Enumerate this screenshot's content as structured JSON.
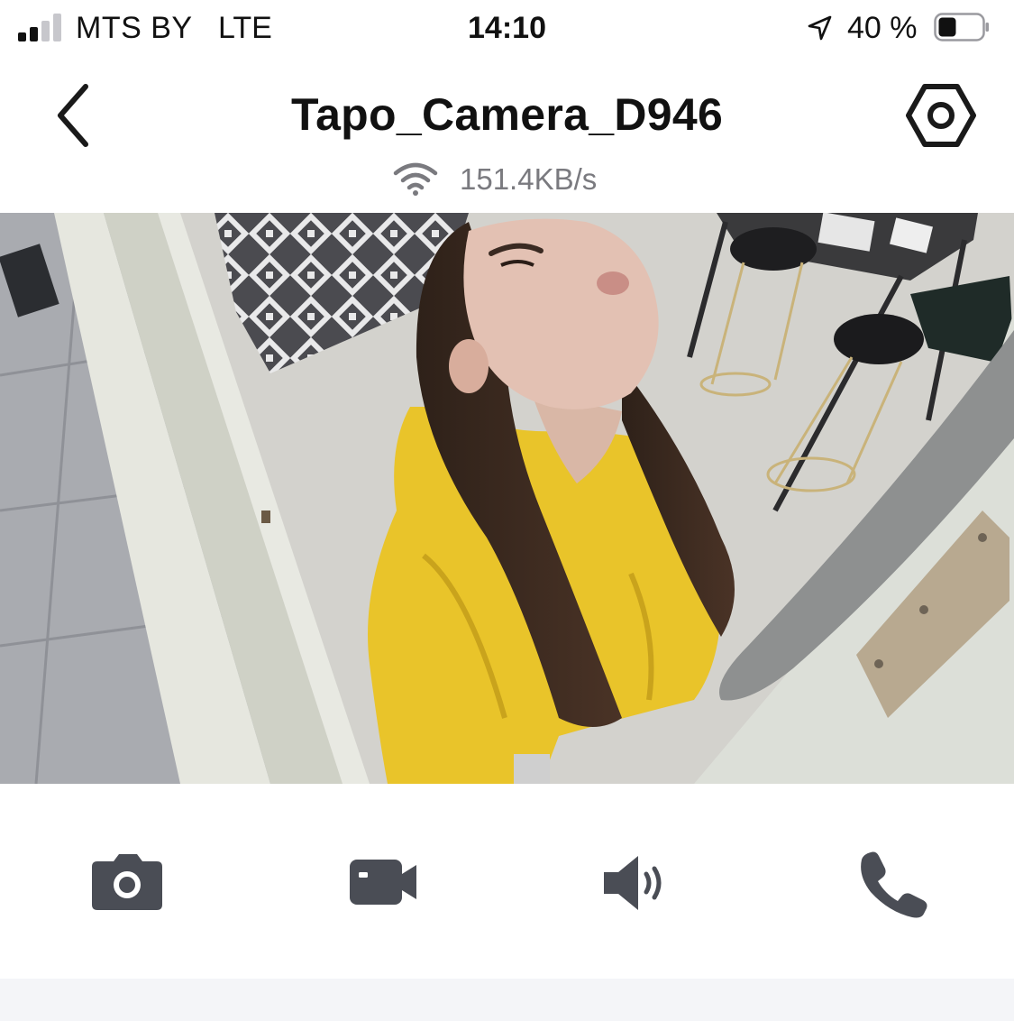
{
  "status_bar": {
    "carrier": "MTS BY",
    "network": "LTE",
    "time": "14:10",
    "battery_percent": "40 %",
    "signal_bars": 2,
    "battery_level": 0.4,
    "icons": [
      "signal-icon",
      "location-arrow-icon",
      "battery-icon"
    ]
  },
  "nav": {
    "title": "Tapo_Camera_D946",
    "back_icon": "chevron-left-icon",
    "settings_icon": "hex-gear-icon"
  },
  "stream": {
    "speed": "151.4KB/s",
    "icon": "wifi-icon"
  },
  "controls": [
    {
      "name": "snapshot",
      "icon": "camera-icon"
    },
    {
      "name": "record",
      "icon": "video-camera-icon"
    },
    {
      "name": "sound",
      "icon": "speaker-icon"
    },
    {
      "name": "call",
      "icon": "phone-icon"
    }
  ],
  "colors": {
    "text": "#111111",
    "muted": "#7a7a7f",
    "icon": "#4a4d55",
    "panel": "#f4f5f8"
  }
}
